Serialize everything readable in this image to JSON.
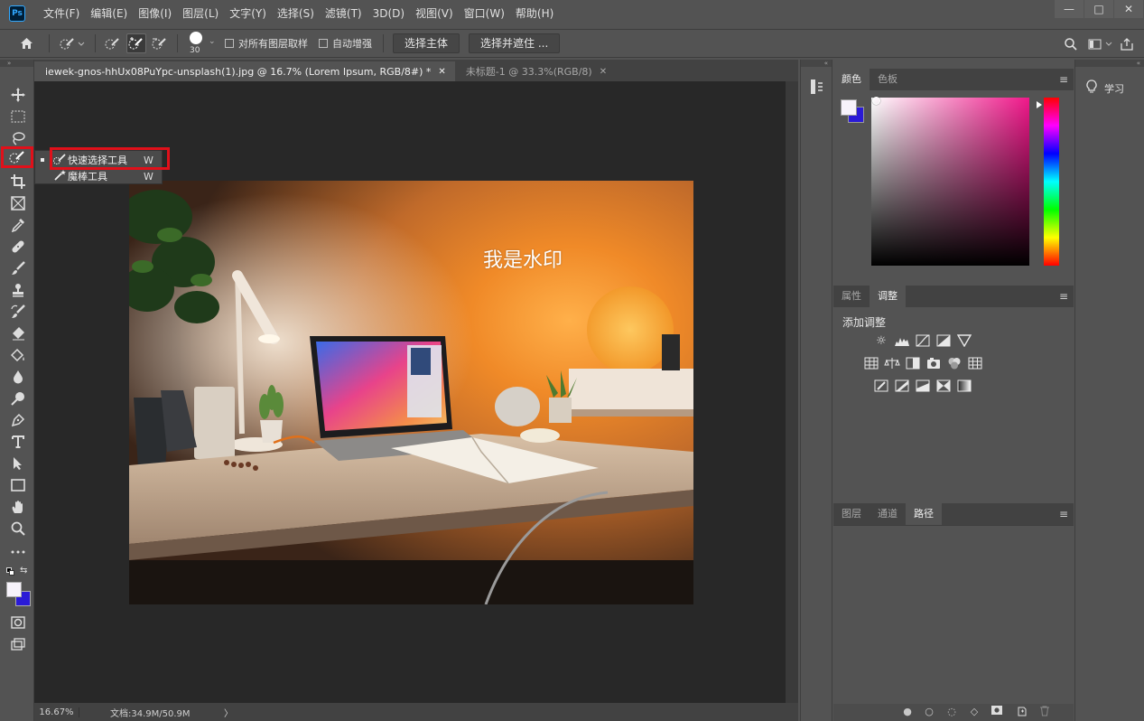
{
  "app": {
    "logo_text": "Ps"
  },
  "menu": [
    "文件(F)",
    "编辑(E)",
    "图像(I)",
    "图层(L)",
    "文字(Y)",
    "选择(S)",
    "滤镜(T)",
    "3D(D)",
    "视图(V)",
    "窗口(W)",
    "帮助(H)"
  ],
  "window_controls": {
    "minimize": "—",
    "maximize": "□",
    "close": "✕"
  },
  "options": {
    "brush_size": "30",
    "sample_all_layers": "对所有图层取样",
    "auto_enhance": "自动增强",
    "select_subject": "选择主体",
    "select_and_mask": "选择并遮住 ..."
  },
  "tabs": [
    {
      "label": "iewek-gnos-hhUx08PuYpc-unsplash(1).jpg @ 16.7% (Lorem Ipsum, RGB/8#) *",
      "active": true
    },
    {
      "label": "未标题-1 @ 33.3%(RGB/8)",
      "active": false
    }
  ],
  "flyout": [
    {
      "label": "快速选择工具",
      "shortcut": "W",
      "selected": true
    },
    {
      "label": "魔棒工具",
      "shortcut": "W",
      "selected": false
    }
  ],
  "watermark": "我是水印",
  "status": {
    "zoom": "16.67%",
    "doc_size": "文档:34.9M/50.9M",
    "arrow": "〉"
  },
  "panels": {
    "color": {
      "tabs": [
        "颜色",
        "色板"
      ],
      "foreground": "#f7f3fb",
      "background": "#2a1ad6",
      "hue": "#f0188a"
    },
    "adjustments": {
      "tabs": [
        "属性",
        "调整"
      ],
      "title": "添加调整"
    },
    "layers": {
      "tabs": [
        "图层",
        "通道",
        "路径"
      ]
    },
    "learn": "学习"
  },
  "colors": {
    "accent_red": "#e0101a",
    "ui_bg": "#535353",
    "canvas_bg": "#282828"
  }
}
